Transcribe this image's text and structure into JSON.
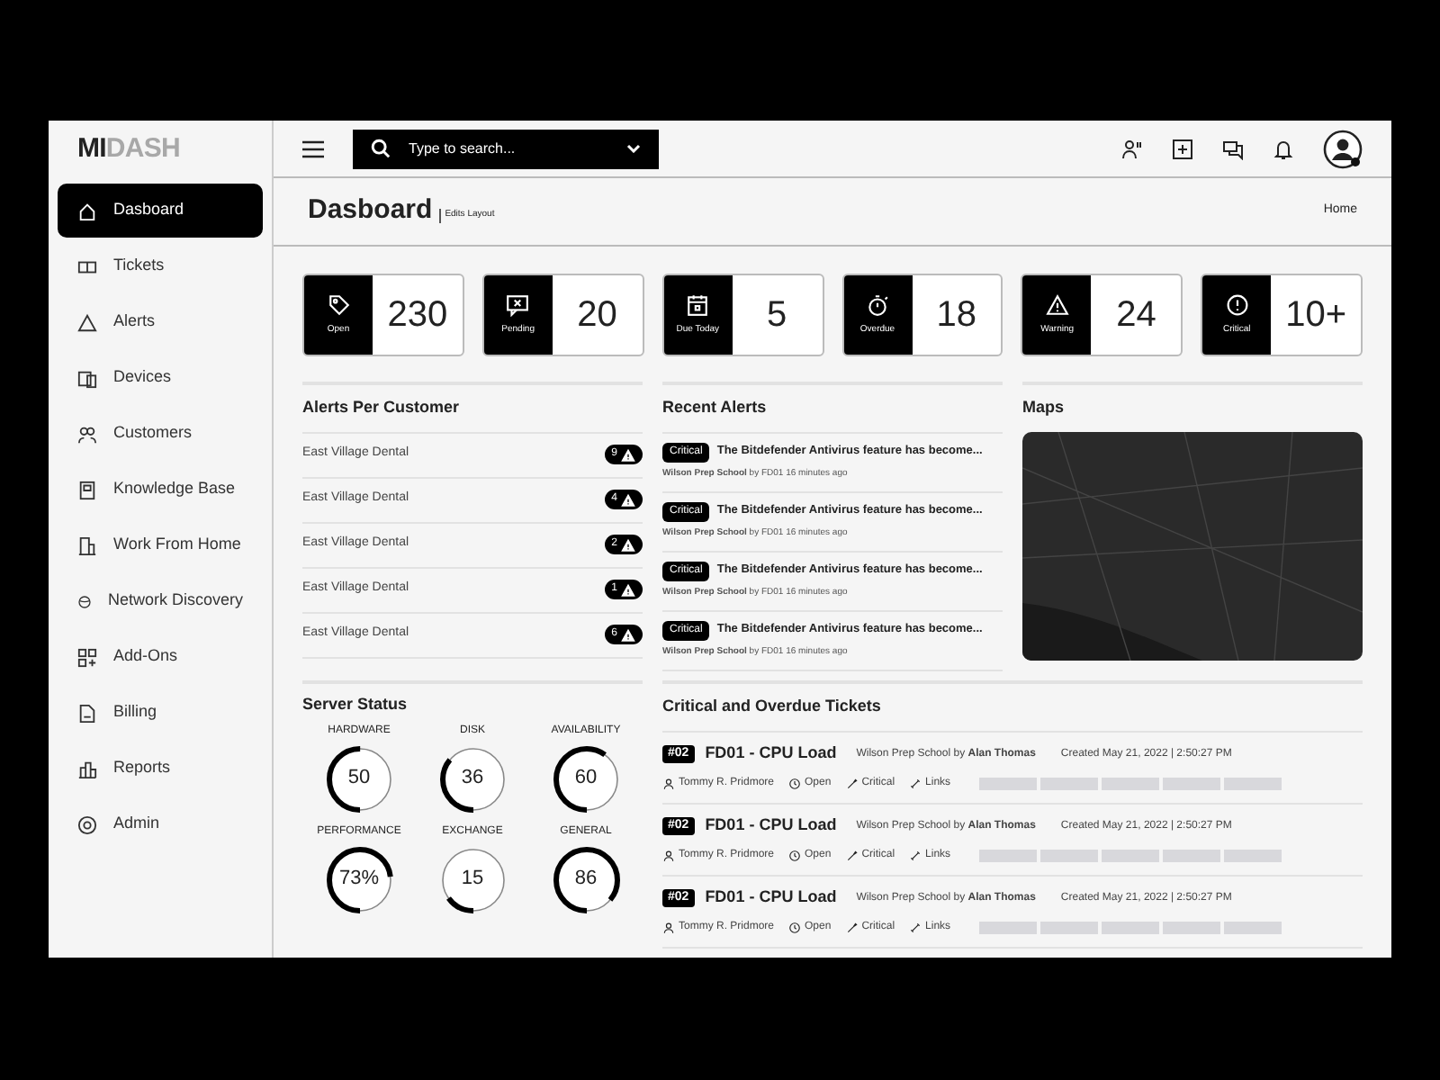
{
  "logo": {
    "strong": "MI",
    "light": "DASH"
  },
  "sidebar": {
    "items": [
      {
        "label": "Dasboard",
        "selected": true
      },
      {
        "label": "Tickets",
        "selected": false
      },
      {
        "label": "Alerts",
        "selected": false
      },
      {
        "label": "Devices",
        "selected": false
      },
      {
        "label": "Customers",
        "selected": false
      },
      {
        "label": "Knowledge Base",
        "selected": false
      },
      {
        "label": "Work From Home",
        "selected": false
      },
      {
        "label": "Network Discovery",
        "selected": false
      },
      {
        "label": "Add-Ons",
        "selected": false
      },
      {
        "label": "Billing",
        "selected": false
      },
      {
        "label": "Reports",
        "selected": false
      },
      {
        "label": "Admin",
        "selected": false
      }
    ]
  },
  "search": {
    "placeholder": "Type to search..."
  },
  "header": {
    "title": "Dasboard",
    "subtitle": "Edits Layout",
    "breadcrumb": "Home"
  },
  "stats": [
    {
      "label": "Open",
      "value": "230"
    },
    {
      "label": "Pending",
      "value": "20"
    },
    {
      "label": "Due Today",
      "value": "5"
    },
    {
      "label": "Overdue",
      "value": "18"
    },
    {
      "label": "Warning",
      "value": "24"
    },
    {
      "label": "Critical",
      "value": "10+"
    }
  ],
  "alerts_per_customer": {
    "title": "Alerts Per Customer",
    "rows": [
      {
        "name": "East Village Dental",
        "count": "9"
      },
      {
        "name": "East Village Dental",
        "count": "4"
      },
      {
        "name": "East Village Dental",
        "count": "2"
      },
      {
        "name": "East Village Dental",
        "count": "1"
      },
      {
        "name": "East Village Dental",
        "count": "6"
      }
    ]
  },
  "recent_alerts": {
    "title": "Recent Alerts",
    "items": [
      {
        "badge": "Critical",
        "text": "The Bitdefender Antivirus feature has become...",
        "meta": "**Wilson Prep School** by FD01 16 minutes ago"
      },
      {
        "badge": "Critical",
        "text": "The Bitdefender Antivirus feature has become...",
        "meta": "**Wilson Prep School** by FD01 16 minutes ago"
      },
      {
        "badge": "Critical",
        "text": "The Bitdefender Antivirus feature has become...",
        "meta": "**Wilson Prep School** by FD01 16 minutes ago"
      },
      {
        "badge": "Critical",
        "text": "The Bitdefender Antivirus feature has become...",
        "meta": "**Wilson Prep School** by FD01 16 minutes ago"
      }
    ]
  },
  "maps": {
    "title": "Maps"
  },
  "server_status": {
    "title": "Server Status",
    "gauges": [
      {
        "label": "HARDWARE",
        "value": "50",
        "level": 0.5
      },
      {
        "label": "DISK",
        "value": "36",
        "level": 0.36
      },
      {
        "label": "AVAILABILITY",
        "value": "60",
        "level": 0.6
      },
      {
        "label": "PERFORMANCE",
        "value": "73%",
        "level": 0.73
      },
      {
        "label": "EXCHANGE",
        "value": "15",
        "level": 0.15
      },
      {
        "label": "GENERAL",
        "value": "86",
        "level": 0.86
      }
    ]
  },
  "tickets": {
    "title": "Critical and Overdue Tickets",
    "rows": [
      {
        "number": "#02",
        "title": "FD01 - CPU Load",
        "source": "Wilson Prep School by **Alan Thomas**",
        "created": "Created May 21, 2022 | 2:50:27 PM",
        "assignee": "Tommy R. Pridmore",
        "status": "Open",
        "priority": "Critical",
        "links": "Links"
      },
      {
        "number": "#02",
        "title": "FD01 - CPU Load",
        "source": "Wilson Prep School by **Alan Thomas**",
        "created": "Created May 21, 2022 | 2:50:27 PM",
        "assignee": "Tommy R. Pridmore",
        "status": "Open",
        "priority": "Critical",
        "links": "Links"
      },
      {
        "number": "#02",
        "title": "FD01 - CPU Load",
        "source": "Wilson Prep School by **Alan Thomas**",
        "created": "Created May 21, 2022 | 2:50:27 PM",
        "assignee": "Tommy R. Pridmore",
        "status": "Open",
        "priority": "Critical",
        "links": "Links"
      }
    ]
  }
}
